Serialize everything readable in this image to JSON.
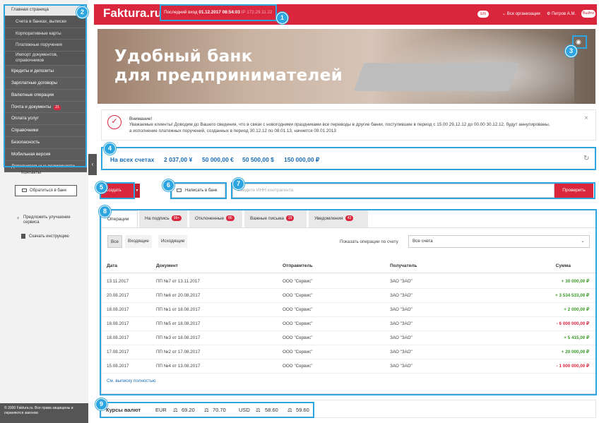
{
  "sidebar": {
    "items": [
      {
        "label": "Главная страница"
      },
      {
        "label": "Счета в банках, выписки"
      },
      {
        "label": "Корпоративные карты"
      },
      {
        "label": "Платежные поручения"
      },
      {
        "label": "Импорт документов, справочников"
      },
      {
        "label": "Кредиты и депозиты"
      },
      {
        "label": "Зарплатные договоры"
      },
      {
        "label": "Валютные операции"
      },
      {
        "label": "Почта и документы",
        "badge": "21"
      },
      {
        "label": "Оплата услуг"
      },
      {
        "label": "Справочники"
      },
      {
        "label": "Безопасность"
      },
      {
        "label": "Мобильная версия"
      },
      {
        "label": "Дополнительные возможности"
      }
    ],
    "contacts": "Контакты",
    "write_bank": "Обратиться в банк",
    "suggest": "Предложить улучшение сервиса",
    "instruction": "Скачать инструкцию",
    "footer": "© 2000 Faktura.ru. Все права защищены и охраняются законом"
  },
  "topbar": {
    "logo": "Faktura.ru",
    "last_login_label": "Последний вход",
    "last_login_value": "01.12.2017 08:54:03",
    "ip": "IP 172.29.11.22",
    "lang": "EN",
    "orgs": "Все организации",
    "user": "Петров А.М.",
    "exit": "Выйти"
  },
  "banner": {
    "line1": "Удобный банк",
    "line2": "для предпринимателей"
  },
  "notice": {
    "title": "Внимание!",
    "text": "Уважаемые клиенты! Доводим до Вашего сведения, что в связи с новогодними праздниками все переводы в другие банки, поступившие в период с 15.00 29.12.12 до 00.00 30.12.12, будут аннулированы, а исполнение платежных поручений, созданных в период 30.12.12 по 08.01.13, начнется 09.01.2013"
  },
  "totals": {
    "label": "На всех счетах",
    "rub1": "2 037,00 ¥",
    "eur": "50 000,00 €",
    "usd": "50 500,00 $",
    "rub2": "150 000,00 ₽"
  },
  "actions": {
    "create": "Создать платеж",
    "write": "Написать в банк",
    "inn_placeholder": "Введите ИНН контрагента",
    "verify": "Проверить"
  },
  "tabs": [
    {
      "label": "Операции"
    },
    {
      "label": "На подпись",
      "count": "99+"
    },
    {
      "label": "Отклоненные",
      "count": "86"
    },
    {
      "label": "Важные письма",
      "count": "19"
    },
    {
      "label": "Уведомления",
      "count": "43"
    }
  ],
  "filters": {
    "all": "Все",
    "incoming": "Входящие",
    "outgoing": "Исходящие",
    "show_label": "Показать операции по счету",
    "account": "Все счета"
  },
  "table": {
    "headers": {
      "date": "Дата",
      "doc": "Документ",
      "sender": "Отправитель",
      "receiver": "Получатель",
      "sum": "Сумма"
    },
    "rows": [
      {
        "date": "13.11.2017",
        "doc": "ПП №7 от 13.11.2017",
        "sender": "ООО \"Сервис\"",
        "receiver": "ЗАО \"ЗАО\"",
        "sum": "+ 30 000,00 ₽",
        "sign": "pos"
      },
      {
        "date": "20.08.2017",
        "doc": "ПП №6 от 20.08.2017",
        "sender": "ООО \"Сервис\"",
        "receiver": "ЗАО \"ЗАО\"",
        "sum": "+ 3 534 533,00 ₽",
        "sign": "pos"
      },
      {
        "date": "18.08.2017",
        "doc": "ПП №1 от 18.08.2017",
        "sender": "ООО \"Сервис\"",
        "receiver": "ЗАО \"ЗАО\"",
        "sum": "+ 2 000,00 ₽",
        "sign": "pos"
      },
      {
        "date": "18.08.2017",
        "doc": "ПП №5 от 18.08.2017",
        "sender": "ООО \"Сервис\"",
        "receiver": "ЗАО \"ЗАО\"",
        "sum": "- 6 000 000,00 ₽",
        "sign": "neg"
      },
      {
        "date": "18.08.2017",
        "doc": "ПП №3 от 18.08.2017",
        "sender": "ООО \"Сервис\"",
        "receiver": "ЗАО \"ЗАО\"",
        "sum": "+ 5 415,00 ₽",
        "sign": "pos"
      },
      {
        "date": "17.08.2017",
        "doc": "ПП №2 от 17.08.2017",
        "sender": "ООО \"Сервис\"",
        "receiver": "ЗАО \"ЗАО\"",
        "sum": "+ 20 000,00 ₽",
        "sign": "pos"
      },
      {
        "date": "15.08.2017",
        "doc": "ПП №4 от 13.08.2017",
        "sender": "ООО \"Сервис\"",
        "receiver": "ЗАО \"ЗАО\"",
        "sum": "- 1 000 000,00 ₽",
        "sign": "neg"
      }
    ],
    "more": "См. выписку полностью"
  },
  "rates": {
    "label": "Курсы валют",
    "eur": "EUR",
    "eur_buy": "69.20",
    "eur_sell": "70.70",
    "usd": "USD",
    "usd_buy": "58.60",
    "usd_sell": "59.60"
  },
  "callouts": [
    "1",
    "2",
    "3",
    "4",
    "5",
    "6",
    "7",
    "8",
    "9"
  ],
  "colors": {
    "brand": "#d9263c",
    "callout": "#2ca5e0",
    "positive": "#3a9a28",
    "sidebar": "#5d5d5d"
  }
}
